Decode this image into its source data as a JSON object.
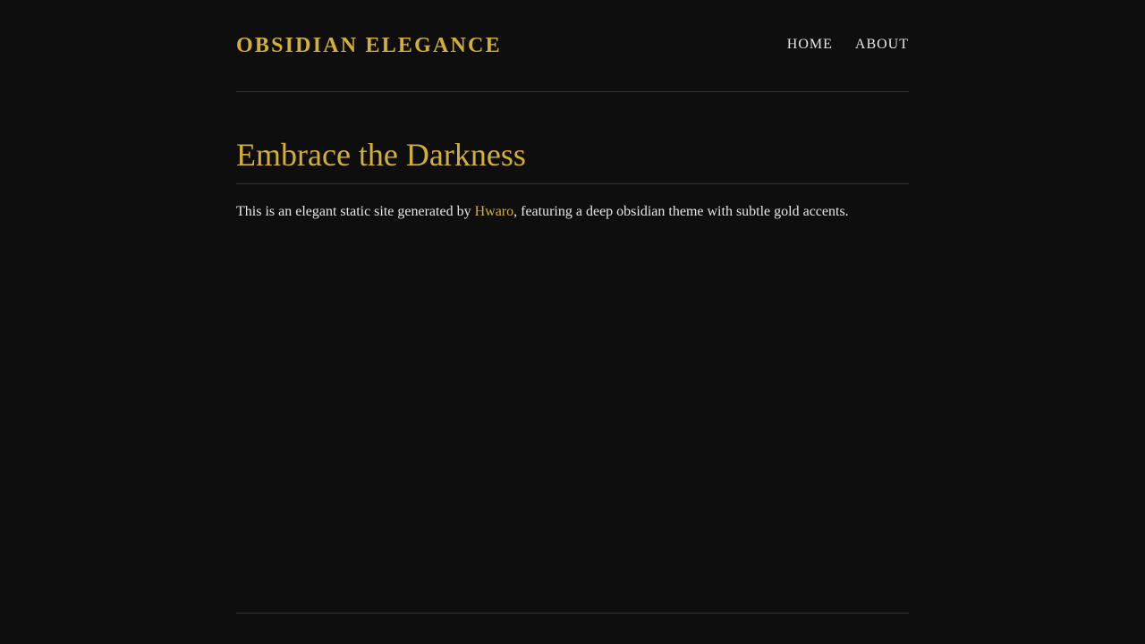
{
  "site": {
    "title": "OBSIDIAN ELEGANCE"
  },
  "nav": {
    "items": [
      {
        "label": "HOME"
      },
      {
        "label": "ABOUT"
      }
    ]
  },
  "main": {
    "heading": "Embrace the Darkness",
    "intro": {
      "before_link": "This is an elegant static site generated by ",
      "link_text": "Hwaro",
      "after_link": ", featuring a deep obsidian theme with subtle gold accents."
    }
  },
  "colors": {
    "background": "#0e0e0e",
    "accent_gold": "#d4af37",
    "text": "#e6e6e6",
    "divider": "#333333"
  }
}
